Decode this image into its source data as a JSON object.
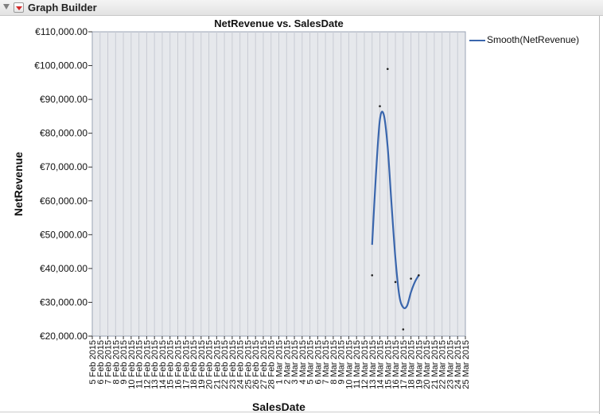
{
  "header": {
    "title": "Graph Builder"
  },
  "legend": {
    "label": "Smooth(NetRevenue)"
  },
  "colors": {
    "line": "#3a66ad",
    "plot_bg": "#e6e8ec",
    "grid": "#c9ccd4",
    "point": "#222222"
  },
  "chart_data": {
    "type": "line",
    "title": "NetRevenue vs. SalesDate",
    "xlabel": "SalesDate",
    "ylabel": "NetRevenue",
    "ylim": [
      20000,
      110000
    ],
    "y_ticks": [
      20000,
      30000,
      40000,
      50000,
      60000,
      70000,
      80000,
      90000,
      100000,
      110000
    ],
    "y_tick_labels": [
      "€20,000.00",
      "€30,000.00",
      "€40,000.00",
      "€50,000.00",
      "€60,000.00",
      "€70,000.00",
      "€80,000.00",
      "€90,000.00",
      "€100,000.00",
      "€110,000.00"
    ],
    "x_tick_labels": [
      "5 Feb 2015",
      "6 Feb 2015",
      "7 Feb 2015",
      "8 Feb 2015",
      "9 Feb 2015",
      "10 Feb 2015",
      "11 Feb 2015",
      "12 Feb 2015",
      "13 Feb 2015",
      "14 Feb 2015",
      "15 Feb 2015",
      "16 Feb 2015",
      "17 Feb 2015",
      "18 Feb 2015",
      "19 Feb 2015",
      "20 Feb 2015",
      "21 Feb 2015",
      "22 Feb 2015",
      "23 Feb 2015",
      "24 Feb 2015",
      "25 Feb 2015",
      "26 Feb 2015",
      "27 Feb 2015",
      "28 Feb 2015",
      "1 Mar 2015",
      "2 Mar 2015",
      "3 Mar 2015",
      "4 Mar 2015",
      "5 Mar 2015",
      "6 Mar 2015",
      "7 Mar 2015",
      "8 Mar 2015",
      "9 Mar 2015",
      "10 Mar 2015",
      "11 Mar 2015",
      "12 Mar 2015",
      "13 Mar 2015",
      "14 Mar 2015",
      "15 Mar 2015",
      "16 Mar 2015",
      "17 Mar 2015",
      "18 Mar 2015",
      "19 Mar 2015",
      "20 Mar 2015",
      "21 Mar 2015",
      "22 Mar 2015",
      "23 Mar 2015",
      "24 Mar 2015",
      "25 Mar 2015"
    ],
    "x_range": [
      "5 Feb 2015",
      "25 Mar 2015"
    ],
    "grid": true,
    "legend_position": "right",
    "points": [
      {
        "x": "13 Mar 2015",
        "y": 38000
      },
      {
        "x": "14 Mar 2015",
        "y": 88000
      },
      {
        "x": "15 Mar 2015",
        "y": 99000
      },
      {
        "x": "16 Mar 2015",
        "y": 36000
      },
      {
        "x": "17 Mar 2015",
        "y": 22000
      },
      {
        "x": "18 Mar 2015",
        "y": 37000
      },
      {
        "x": "19 Mar 2015",
        "y": 38000
      }
    ],
    "series": [
      {
        "name": "Smooth(NetRevenue)",
        "x": [
          "13 Mar 2015",
          "13.5 Mar 2015",
          "14 Mar 2015",
          "14.5 Mar 2015",
          "15 Mar 2015",
          "15.5 Mar 2015",
          "16 Mar 2015",
          "16.5 Mar 2015",
          "17 Mar 2015",
          "17.5 Mar 2015",
          "18 Mar 2015",
          "18.5 Mar 2015",
          "19 Mar 2015"
        ],
        "values": [
          47000,
          68000,
          84000,
          85500,
          76000,
          59000,
          43000,
          32000,
          28500,
          29000,
          33000,
          36000,
          38000
        ]
      }
    ]
  }
}
